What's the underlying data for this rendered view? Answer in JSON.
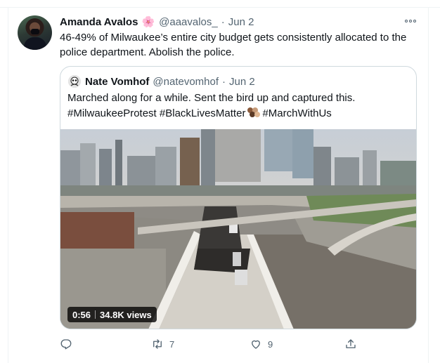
{
  "tweet": {
    "author_name": "Amanda Avalos",
    "author_emoji": "🌸",
    "handle": "@aaavalos_",
    "separator": "·",
    "date": "Jun 2",
    "text": "46-49% of Milwaukee’s entire city budget gets consistently allocated to the police department. Abolish the police."
  },
  "quoted": {
    "author_name": "Nate Vomhof",
    "handle": "@natevomhof",
    "separator": "·",
    "date": "Jun 2",
    "text_line1": "Marched along for a while. Sent the bird up and captured this.",
    "text_line2_a": "#MilwaukeeProtest #BlackLivesMatter",
    "text_line2_b": "#MarchWithUs",
    "video": {
      "duration": "0:56",
      "views": "34.8K views"
    }
  },
  "actions": {
    "reply_count": "",
    "retweet_count": "7",
    "like_count": "9"
  },
  "icons": {
    "more": "more-horizontal-icon",
    "reply": "reply-icon",
    "retweet": "retweet-icon",
    "like": "heart-icon",
    "share": "share-icon"
  },
  "colors": {
    "text": "#0f1419",
    "muted": "#536471",
    "border": "#cfd9de"
  }
}
